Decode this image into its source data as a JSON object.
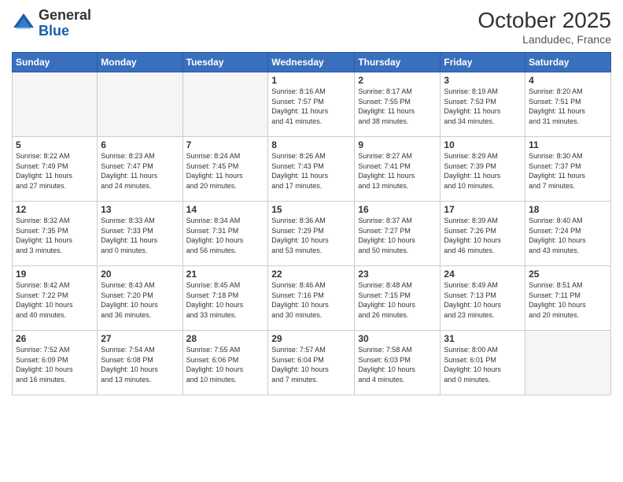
{
  "logo": {
    "general": "General",
    "blue": "Blue"
  },
  "title": "October 2025",
  "location": "Landudec, France",
  "days_header": [
    "Sunday",
    "Monday",
    "Tuesday",
    "Wednesday",
    "Thursday",
    "Friday",
    "Saturday"
  ],
  "weeks": [
    [
      {
        "day": "",
        "info": ""
      },
      {
        "day": "",
        "info": ""
      },
      {
        "day": "",
        "info": ""
      },
      {
        "day": "1",
        "info": "Sunrise: 8:16 AM\nSunset: 7:57 PM\nDaylight: 11 hours\nand 41 minutes."
      },
      {
        "day": "2",
        "info": "Sunrise: 8:17 AM\nSunset: 7:55 PM\nDaylight: 11 hours\nand 38 minutes."
      },
      {
        "day": "3",
        "info": "Sunrise: 8:19 AM\nSunset: 7:53 PM\nDaylight: 11 hours\nand 34 minutes."
      },
      {
        "day": "4",
        "info": "Sunrise: 8:20 AM\nSunset: 7:51 PM\nDaylight: 11 hours\nand 31 minutes."
      }
    ],
    [
      {
        "day": "5",
        "info": "Sunrise: 8:22 AM\nSunset: 7:49 PM\nDaylight: 11 hours\nand 27 minutes."
      },
      {
        "day": "6",
        "info": "Sunrise: 8:23 AM\nSunset: 7:47 PM\nDaylight: 11 hours\nand 24 minutes."
      },
      {
        "day": "7",
        "info": "Sunrise: 8:24 AM\nSunset: 7:45 PM\nDaylight: 11 hours\nand 20 minutes."
      },
      {
        "day": "8",
        "info": "Sunrise: 8:26 AM\nSunset: 7:43 PM\nDaylight: 11 hours\nand 17 minutes."
      },
      {
        "day": "9",
        "info": "Sunrise: 8:27 AM\nSunset: 7:41 PM\nDaylight: 11 hours\nand 13 minutes."
      },
      {
        "day": "10",
        "info": "Sunrise: 8:29 AM\nSunset: 7:39 PM\nDaylight: 11 hours\nand 10 minutes."
      },
      {
        "day": "11",
        "info": "Sunrise: 8:30 AM\nSunset: 7:37 PM\nDaylight: 11 hours\nand 7 minutes."
      }
    ],
    [
      {
        "day": "12",
        "info": "Sunrise: 8:32 AM\nSunset: 7:35 PM\nDaylight: 11 hours\nand 3 minutes."
      },
      {
        "day": "13",
        "info": "Sunrise: 8:33 AM\nSunset: 7:33 PM\nDaylight: 11 hours\nand 0 minutes."
      },
      {
        "day": "14",
        "info": "Sunrise: 8:34 AM\nSunset: 7:31 PM\nDaylight: 10 hours\nand 56 minutes."
      },
      {
        "day": "15",
        "info": "Sunrise: 8:36 AM\nSunset: 7:29 PM\nDaylight: 10 hours\nand 53 minutes."
      },
      {
        "day": "16",
        "info": "Sunrise: 8:37 AM\nSunset: 7:27 PM\nDaylight: 10 hours\nand 50 minutes."
      },
      {
        "day": "17",
        "info": "Sunrise: 8:39 AM\nSunset: 7:26 PM\nDaylight: 10 hours\nand 46 minutes."
      },
      {
        "day": "18",
        "info": "Sunrise: 8:40 AM\nSunset: 7:24 PM\nDaylight: 10 hours\nand 43 minutes."
      }
    ],
    [
      {
        "day": "19",
        "info": "Sunrise: 8:42 AM\nSunset: 7:22 PM\nDaylight: 10 hours\nand 40 minutes."
      },
      {
        "day": "20",
        "info": "Sunrise: 8:43 AM\nSunset: 7:20 PM\nDaylight: 10 hours\nand 36 minutes."
      },
      {
        "day": "21",
        "info": "Sunrise: 8:45 AM\nSunset: 7:18 PM\nDaylight: 10 hours\nand 33 minutes."
      },
      {
        "day": "22",
        "info": "Sunrise: 8:46 AM\nSunset: 7:16 PM\nDaylight: 10 hours\nand 30 minutes."
      },
      {
        "day": "23",
        "info": "Sunrise: 8:48 AM\nSunset: 7:15 PM\nDaylight: 10 hours\nand 26 minutes."
      },
      {
        "day": "24",
        "info": "Sunrise: 8:49 AM\nSunset: 7:13 PM\nDaylight: 10 hours\nand 23 minutes."
      },
      {
        "day": "25",
        "info": "Sunrise: 8:51 AM\nSunset: 7:11 PM\nDaylight: 10 hours\nand 20 minutes."
      }
    ],
    [
      {
        "day": "26",
        "info": "Sunrise: 7:52 AM\nSunset: 6:09 PM\nDaylight: 10 hours\nand 16 minutes."
      },
      {
        "day": "27",
        "info": "Sunrise: 7:54 AM\nSunset: 6:08 PM\nDaylight: 10 hours\nand 13 minutes."
      },
      {
        "day": "28",
        "info": "Sunrise: 7:55 AM\nSunset: 6:06 PM\nDaylight: 10 hours\nand 10 minutes."
      },
      {
        "day": "29",
        "info": "Sunrise: 7:57 AM\nSunset: 6:04 PM\nDaylight: 10 hours\nand 7 minutes."
      },
      {
        "day": "30",
        "info": "Sunrise: 7:58 AM\nSunset: 6:03 PM\nDaylight: 10 hours\nand 4 minutes."
      },
      {
        "day": "31",
        "info": "Sunrise: 8:00 AM\nSunset: 6:01 PM\nDaylight: 10 hours\nand 0 minutes."
      },
      {
        "day": "",
        "info": ""
      }
    ]
  ]
}
